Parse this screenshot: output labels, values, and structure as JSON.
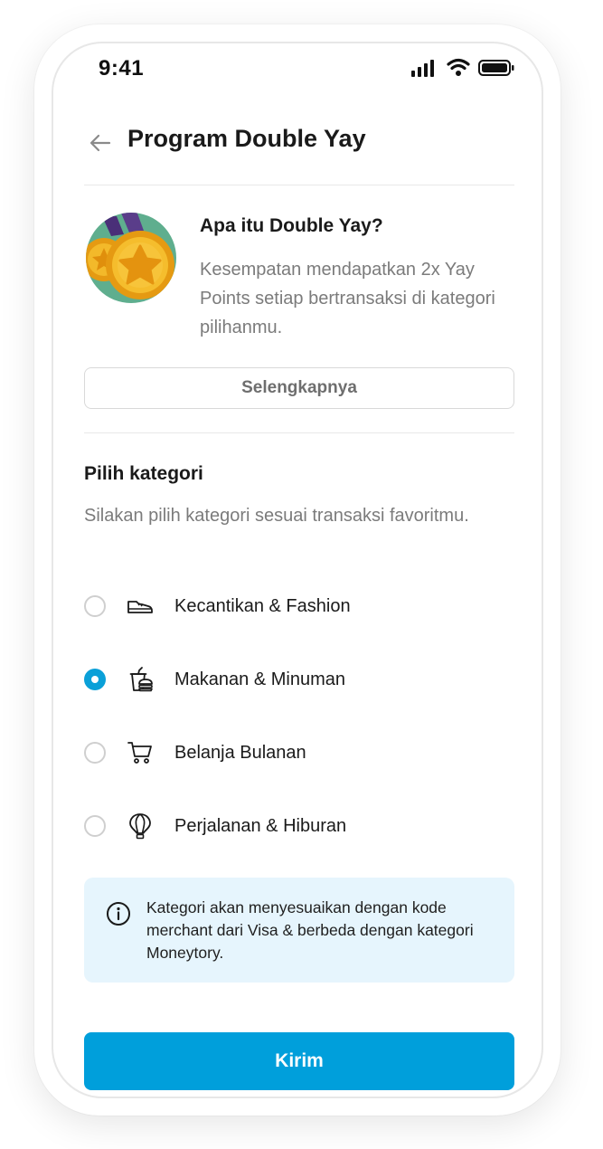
{
  "status_bar": {
    "time": "9:41",
    "icons": [
      "signal-icon",
      "wifi-icon",
      "battery-icon"
    ]
  },
  "header": {
    "back_icon": "arrow-left-icon",
    "title": "Program Double Yay"
  },
  "intro": {
    "image_icon": "medal-icon",
    "title": "Apa itu Double Yay?",
    "description": "Kesempatan mendapatkan 2x Yay Points setiap bertransaksi di kategori pilihanmu.",
    "more_button_label": "Selengkapnya"
  },
  "category": {
    "title": "Pilih kategori",
    "description": "Silakan pilih kategori sesuai transaksi favoritmu.",
    "options": [
      {
        "label": "Kecantikan & Fashion",
        "icon": "sneaker-icon",
        "selected": false
      },
      {
        "label": "Makanan & Minuman",
        "icon": "food-drink-icon",
        "selected": true
      },
      {
        "label": "Belanja Bulanan",
        "icon": "shopping-cart-icon",
        "selected": false
      },
      {
        "label": "Perjalanan & Hiburan",
        "icon": "hot-air-balloon-icon",
        "selected": false
      }
    ]
  },
  "info": {
    "icon": "info-icon",
    "text": "Kategori akan menyesuaikan dengan kode merchant dari Visa & berbeda dengan kategori Moneytory."
  },
  "submit_button_label": "Kirim",
  "colors": {
    "accent": "#009fdb",
    "info_background": "#e6f5fd",
    "text_primary": "#1a1a1a",
    "text_secondary": "#7b7b7b"
  }
}
